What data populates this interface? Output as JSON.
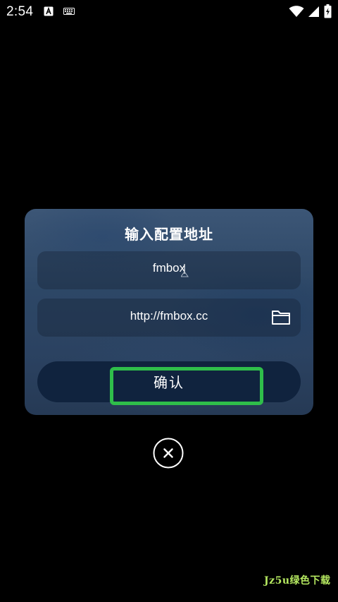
{
  "status_bar": {
    "time": "2:54",
    "icons": [
      "a-notification-icon",
      "keyboard-icon",
      "wifi-icon",
      "signal-icon",
      "battery-icon"
    ]
  },
  "dialog": {
    "title": "输入配置地址",
    "name_field": {
      "value": "fmbox"
    },
    "url_field": {
      "value": "http://fmbox.cc",
      "icon": "folder-icon"
    },
    "confirm_label": "确认"
  },
  "close_button": {
    "icon": "close-icon"
  },
  "colors": {
    "background": "#000000",
    "dialog_top": "#3c5676",
    "dialog_bottom": "#263a55",
    "confirm_button": "#10233e",
    "highlight": "#2fbe4a",
    "text": "#ffffff"
  },
  "watermark": {
    "text": "Jz5u绿色下载"
  }
}
